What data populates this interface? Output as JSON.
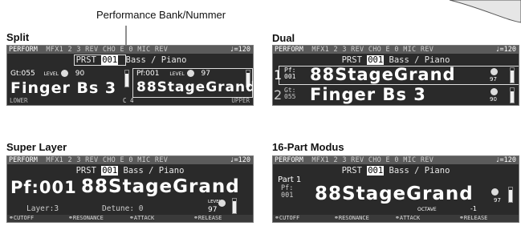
{
  "callout": "Performance Bank/Nummer",
  "status": {
    "mode": "PERFORM",
    "fx_items": [
      "MFX1",
      "2",
      "3",
      "REV",
      "CHO",
      "E",
      "0",
      "MIC",
      "REV"
    ],
    "tempo": "♩=120"
  },
  "preset": {
    "prefix": "PRST",
    "number": "001",
    "name": "Bass / Piano"
  },
  "split": {
    "label": "Split",
    "gt": "Gt:055",
    "level_label": "LEVEL",
    "level_left": "90",
    "tone_left": "Finger Bs 3",
    "pf": "Pf:001",
    "level_right": "97",
    "tone_right": "88StageGrand",
    "lower": "LOWER",
    "key": "C 4",
    "upper": "UPPER"
  },
  "dual": {
    "label": "Dual",
    "row1_num": "1",
    "row1_cat": "Pf:",
    "row1_id": "001",
    "row1_name": "88StageGrand",
    "row1_level": "97",
    "row2_num": "2",
    "row2_cat": "Gt:",
    "row2_id": "055",
    "row2_name": "Finger Bs 3",
    "row2_level": "90"
  },
  "super": {
    "label": "Super Layer",
    "pf": "Pf:001",
    "name": "88StageGrand",
    "layer": "Layer:3",
    "detune": "Detune: 0",
    "level_label": "LEVEL",
    "level": "97",
    "funcs": [
      "CUTOFF",
      "RESONANCE",
      "ATTACK",
      "RELEASE"
    ]
  },
  "part16": {
    "label": "16-Part Modus",
    "part": "Part 1",
    "cat": "Pf:",
    "id": "001",
    "name": "88StageGrand",
    "level": "97",
    "octave_label": "OCTAVE",
    "octave": "-1",
    "funcs": [
      "CUTOFF",
      "RESONANCE",
      "ATTACK",
      "RELEASE"
    ]
  },
  "meters": {
    "split_left": 0.8,
    "split_right": 0.85,
    "dual_1": 0.85,
    "dual_2": 0.8,
    "super": 0.85,
    "part16": 0.85
  }
}
